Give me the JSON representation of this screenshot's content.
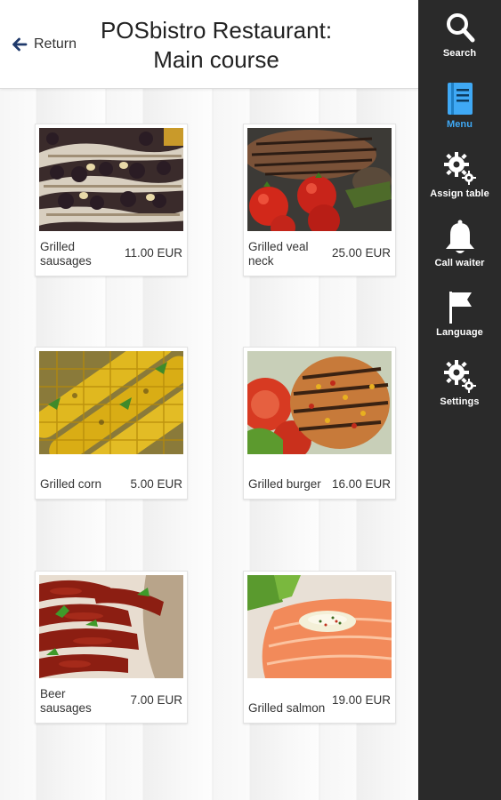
{
  "header": {
    "return_label": "Return",
    "title_line1": "POSbistro Restaurant:",
    "title_line2": "Main course"
  },
  "products": [
    {
      "name": "Grilled sausages",
      "price": "11.00 EUR"
    },
    {
      "name": "Grilled veal neck",
      "price": "25.00 EUR"
    },
    {
      "name": "Grilled corn",
      "price": "5.00 EUR"
    },
    {
      "name": "Grilled burger",
      "price": "16.00 EUR"
    },
    {
      "name": "Beer sausages",
      "price": "7.00 EUR"
    },
    {
      "name": "Grilled salmon",
      "price": "19.00 EUR"
    }
  ],
  "sidebar": {
    "active_color": "#3fa9f5",
    "items": [
      {
        "label": "Search",
        "icon": "search-icon"
      },
      {
        "label": "Menu",
        "icon": "menu-book-icon"
      },
      {
        "label": "Assign table",
        "icon": "gears-icon"
      },
      {
        "label": "Call waiter",
        "icon": "bell-icon"
      },
      {
        "label": "Language",
        "icon": "flag-icon"
      },
      {
        "label": "Settings",
        "icon": "gears-icon"
      }
    ]
  }
}
